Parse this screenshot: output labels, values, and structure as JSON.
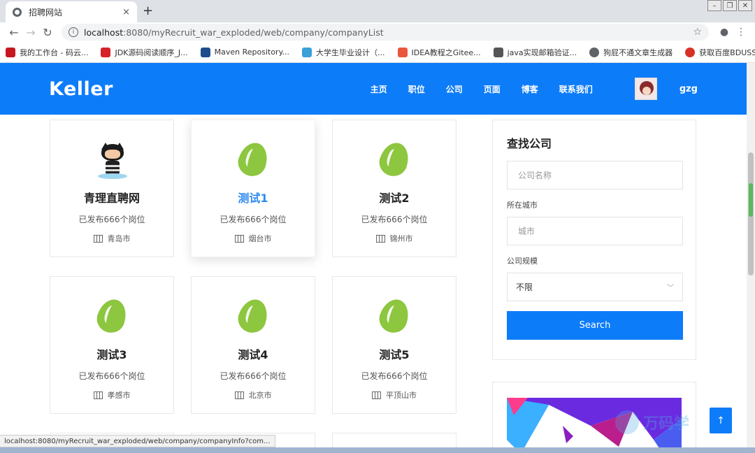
{
  "browser": {
    "tab_title": "招聘网站",
    "tab_close": "×",
    "new_tab": "+",
    "url_host": "localhost",
    "url_path": ":8080/myRecruit_war_exploded/web/company/companyList",
    "bookmarks": [
      {
        "label": "我的工作台 - 码云...",
        "color": "#c7161e"
      },
      {
        "label": "JDK源码阅读顺序_J...",
        "color": "#d6202a"
      },
      {
        "label": "Maven Repository...",
        "color": "#1f4d8c"
      },
      {
        "label": "大学生毕业设计（...",
        "color": "#3aa0d8"
      },
      {
        "label": "IDEA教程之Gitee...",
        "color": "#e8573d"
      },
      {
        "label": "java实现邮箱验证...",
        "color": "#555555"
      },
      {
        "label": "狗屁不通文章生成器",
        "color": "#5f6368"
      },
      {
        "label": "获取百度BDUSS",
        "color": "#d93025"
      }
    ],
    "bookmarks_more": "»",
    "status_url": "localhost:8080/myRecruit_war_exploded/web/company/companyInfo?com..."
  },
  "header": {
    "logo": "Keller",
    "nav": [
      "主页",
      "职位",
      "公司",
      "页面",
      "博客",
      "联系我们"
    ],
    "username": "gzg"
  },
  "companies": [
    {
      "name": "青理直聘网",
      "jobs": "已发布666个岗位",
      "city": "青岛市",
      "logo": "octocat-icon"
    },
    {
      "name": "测试1",
      "jobs": "已发布666个岗位",
      "city": "烟台市",
      "logo": "evernote-leaf-icon"
    },
    {
      "name": "测试2",
      "jobs": "已发布666个岗位",
      "city": "锦州市",
      "logo": "evernote-leaf-icon"
    },
    {
      "name": "测试3",
      "jobs": "已发布666个岗位",
      "city": "孝感市",
      "logo": "evernote-leaf-icon"
    },
    {
      "name": "测试4",
      "jobs": "已发布666个岗位",
      "city": "北京市",
      "logo": "evernote-leaf-icon"
    },
    {
      "name": "测试5",
      "jobs": "已发布666个岗位",
      "city": "平顶山市",
      "logo": "evernote-leaf-icon"
    }
  ],
  "search": {
    "title": "查找公司",
    "name_placeholder": "公司名称",
    "city_label": "所在城市",
    "city_placeholder": "城市",
    "size_label": "公司规模",
    "size_value": "不限",
    "button": "Search"
  },
  "watermark": "万码学",
  "totop": "↑",
  "colors": {
    "primary": "#0d7cf9",
    "leaf": "#8dc63f",
    "active_name": "#2f8cf0"
  }
}
